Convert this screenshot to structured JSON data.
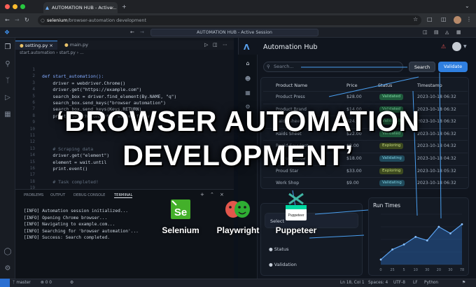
{
  "browser": {
    "tab_title": "AUTOMATION HUB - Active...",
    "url_domain": "selenium",
    "url_path": "/browser-automation development",
    "profile_initial": "A"
  },
  "vscode": {
    "window_title": "AUTOMATION HUB - Active Session",
    "tabs": [
      {
        "label": "setting.py",
        "active": true
      },
      {
        "label": "main.py",
        "active": false
      }
    ],
    "breadcrumb": "start.automation › start.py › ...",
    "line_numbers": [
      "1",
      "2",
      "3",
      "4",
      "5",
      "6",
      "7",
      "8",
      "9",
      "10",
      "11",
      "12",
      "13",
      "14",
      "15",
      "16",
      "17",
      "18",
      "19"
    ],
    "code_lines": [
      "",
      "def start_automation():",
      "    driver = webdriver.Chrome()",
      "    driver.get(\"https://example.com\")",
      "    search_box = driver.find_element(By.NAME, \"q\")",
      "    search_box.send_keys(\"browser automation\")",
      "    search_box.send_keys(Keys.RETURN)",
      "    print(\"Search completed successfully.\")",
      "",
      "",
      "",
      "",
      "    # Scraping data",
      "    driver.get(\"element\")",
      "    element = wait.until",
      "    print.event()",
      "",
      "    # Task completed!"
    ],
    "panel_tabs": [
      "PROBLEMS",
      "OUTPUT",
      "DEBUG CONSOLE",
      "TERMINAL"
    ],
    "terminal_lines": [
      "[INFO] Automation session initialized...",
      "[INFO] Opening Chrome browser...",
      "[INFO] Navigating to example.com...",
      "[INFO] Searching for 'browser automation'...",
      "[INFO] Success: Search completed."
    ],
    "status_left": "master",
    "status_counts": "0  0",
    "status_right": [
      "Ln 18, Col 1",
      "Spaces: 4",
      "UTF-8",
      "LF",
      "Python"
    ]
  },
  "app": {
    "title": "Automation Hub",
    "search_placeholder": "Search...",
    "search_button": "Search",
    "validate_button": "Validate",
    "columns": [
      "Product Name",
      "Price",
      "Status",
      "Timestamp"
    ],
    "rows": [
      {
        "name": "Product Press",
        "price": "$28.00",
        "status": "Validated",
        "time": "2023-10-18 06:32"
      },
      {
        "name": "Product Brand",
        "price": "$14.00",
        "status": "Validated",
        "time": "2023-10-18 06:32"
      },
      {
        "name": "Raids Sheet",
        "price": "$24.00",
        "status": "Validated",
        "time": "2023-10-18 06:32"
      },
      {
        "name": "Raids Sheet",
        "price": "$22.00",
        "status": "Validated",
        "time": "2023-10-18 06:32"
      },
      {
        "name": "Rapid Savviget",
        "price": "$8.00",
        "status": "Exploring",
        "time": "2023-10-18 04:32"
      },
      {
        "name": "Product Mode",
        "price": "$18.00",
        "status": "Validating",
        "time": "2023-10-18 04:32"
      },
      {
        "name": "Proud Star",
        "price": "$33.00",
        "status": "Exploring",
        "time": "2023-10-18 05:32"
      },
      {
        "name": "Work Shop",
        "price": "$9.00",
        "status": "Validating",
        "time": "2023-10-18 06:32"
      }
    ],
    "left_card_items": [
      "Select",
      "Status",
      "Validation"
    ],
    "chart_title": "Run Times",
    "colors": {
      "accent": "#2f7fe0",
      "status_green": "#1f5b3c"
    }
  },
  "headline": {
    "line1": "‘BROWSER AUTOMATION",
    "line2": "DEVELOPMENT’"
  },
  "tools": [
    {
      "label": "Selenium",
      "icon": "selenium-logo"
    },
    {
      "label": "Playwright",
      "icon": "playwright-logo"
    },
    {
      "label": "Puppeteer",
      "icon": "puppeteer-logo"
    }
  ],
  "chart_data": {
    "type": "area",
    "title": "Run Times",
    "x": [
      "0",
      "25",
      "5",
      "10",
      "30",
      "20",
      "30",
      "78"
    ],
    "series": [
      {
        "values": [
          10,
          30,
          40,
          55,
          48,
          75,
          62,
          80
        ]
      }
    ],
    "ylim": [
      0,
      100
    ],
    "xlabel": "",
    "ylabel": "",
    "grid": true
  }
}
